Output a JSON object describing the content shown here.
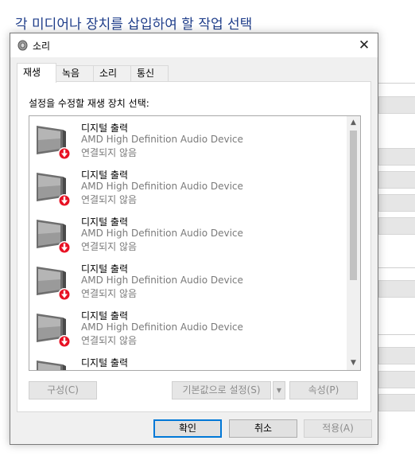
{
  "background": {
    "heading": "각 미디어나 장치를 삽입하여 할 작업 선택"
  },
  "dialog": {
    "title": "소리",
    "close_label": "✕",
    "tabs": [
      {
        "label": "재생",
        "active": true
      },
      {
        "label": "녹음",
        "active": false
      },
      {
        "label": "소리",
        "active": false
      },
      {
        "label": "통신",
        "active": false
      }
    ],
    "instruction": "설정을 수정할 재생 장치 선택:",
    "devices": [
      {
        "name": "디지털 출력",
        "description": "AMD High Definition Audio Device",
        "status": "연결되지 않음"
      },
      {
        "name": "디지털 출력",
        "description": "AMD High Definition Audio Device",
        "status": "연결되지 않음"
      },
      {
        "name": "디지털 출력",
        "description": "AMD High Definition Audio Device",
        "status": "연결되지 않음"
      },
      {
        "name": "디지털 출력",
        "description": "AMD High Definition Audio Device",
        "status": "연결되지 않음"
      },
      {
        "name": "디지털 출력",
        "description": "AMD High Definition Audio Device",
        "status": "연결되지 않음"
      },
      {
        "name": "디지털 출력",
        "description": "",
        "status": ""
      }
    ],
    "buttons": {
      "configure": "구성(C)",
      "set_default": "기본값으로 설정(S)",
      "properties": "속성(P)",
      "ok": "확인",
      "cancel": "취소",
      "apply": "적용(A)"
    },
    "colors": {
      "accent": "#0078d7",
      "status_error": "#e81123",
      "heading": "#1e3d8a"
    }
  }
}
